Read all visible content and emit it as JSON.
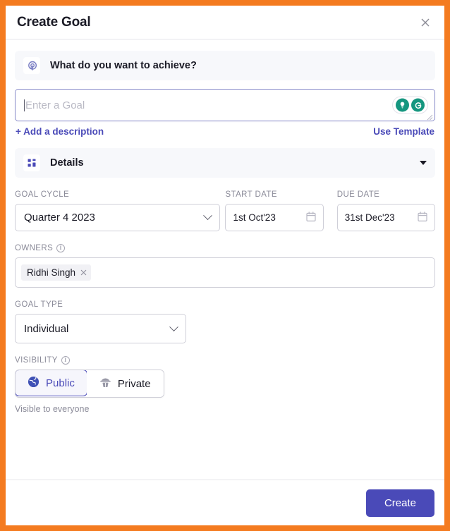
{
  "window": {
    "accent_border_color": "#F47B20",
    "title": "Create Goal",
    "close_icon": "close-icon"
  },
  "achieve": {
    "icon": "goal-target-icon",
    "label": "What do you want to achieve?"
  },
  "goal_input": {
    "value": "",
    "placeholder": "Enter a Goal",
    "border_color": "#8b8ecb",
    "actions": [
      {
        "icon": "lightbulb-icon",
        "color": "#15967f"
      },
      {
        "icon": "ai-generate-icon",
        "color": "#15967f"
      }
    ]
  },
  "links": {
    "add_description": "+ Add a description",
    "use_template": "Use Template",
    "color": "#4a4ab8"
  },
  "details": {
    "icon": "grid-dashboard-icon",
    "label": "Details",
    "expanded": true,
    "chevron": "chevron-down-icon"
  },
  "fields": {
    "goal_cycle": {
      "label": "GOAL CYCLE",
      "value": "Quarter 4 2023",
      "chevron": "chevron-down-icon"
    },
    "start_date": {
      "label": "START DATE",
      "value": "1st Oct'23",
      "icon": "calendar-icon"
    },
    "due_date": {
      "label": "DUE DATE",
      "value": "31st Dec'23",
      "icon": "calendar-icon"
    },
    "owners": {
      "label": "OWNERS",
      "info_icon": "info-icon",
      "chips": [
        {
          "name": "Ridhi Singh",
          "remove_icon": "close-icon"
        }
      ]
    },
    "goal_type": {
      "label": "GOAL TYPE",
      "value": "Individual",
      "chevron": "chevron-down-icon"
    },
    "visibility": {
      "label": "VISIBILITY",
      "info_icon": "info-icon",
      "options": [
        {
          "label": "Public",
          "icon": "globe-icon",
          "selected": true
        },
        {
          "label": "Private",
          "icon": "detective-icon",
          "selected": false
        }
      ],
      "note": "Visible to everyone",
      "selected_color": "#4a4ab8"
    }
  },
  "footer": {
    "create_label": "Create",
    "create_color": "#4a4ab8"
  }
}
